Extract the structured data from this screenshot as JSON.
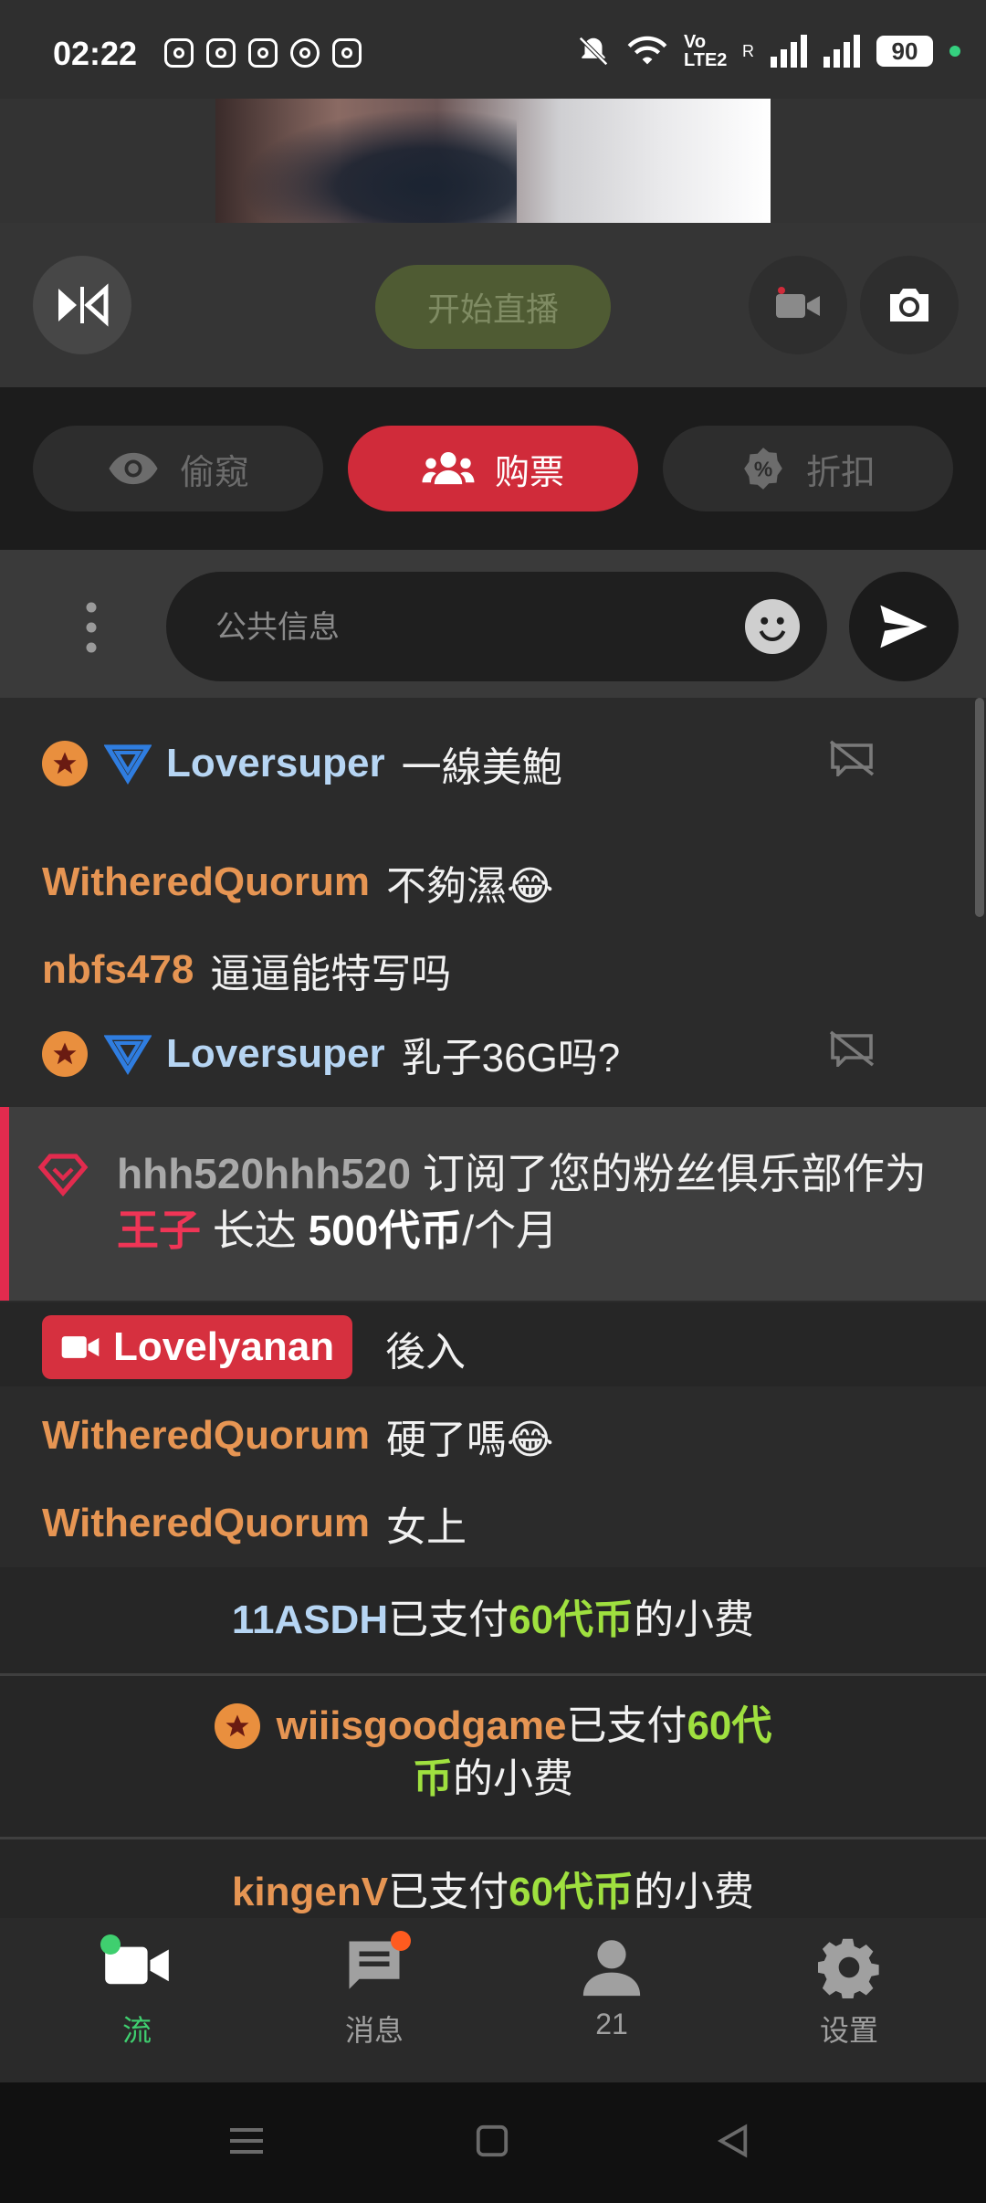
{
  "status_bar": {
    "time": "02:22",
    "network": "Vo LTE2",
    "roaming": "R",
    "battery": "90"
  },
  "controls": {
    "start_label": "开始直播"
  },
  "tabs": [
    {
      "label": "偷窥",
      "icon": "eye-icon",
      "active": false
    },
    {
      "label": "购票",
      "icon": "users-icon",
      "active": true
    },
    {
      "label": "折扣",
      "icon": "discount-icon",
      "active": false
    }
  ],
  "input": {
    "placeholder": "公共信息"
  },
  "chat": [
    {
      "user": "Loversuper",
      "text": "一線美鮑"
    },
    {
      "user": "WitheredQuorum",
      "text": "不夠濕😂"
    },
    {
      "user": "nbfs478",
      "text": "逼逼能特写吗"
    },
    {
      "user": "Loversuper",
      "text": "乳子36G吗?"
    }
  ],
  "subscription": {
    "user": "hhh520hhh520",
    "text1": "订阅了您的粉丝俱乐部作为",
    "rank": "王子",
    "text2": "长达",
    "price": "500代币",
    "text3": "/个月"
  },
  "join": {
    "user": "Lovelyanan",
    "text": "後入"
  },
  "chat2": [
    {
      "user": "WitheredQuorum",
      "text": "硬了嗎😂"
    },
    {
      "user": "WitheredQuorum",
      "text": "女上"
    }
  ],
  "tips": [
    {
      "user": "11ASDH",
      "pre": "已支付",
      "amount": "60代币",
      "post": "的小费"
    },
    {
      "user": "wiiisgoodgame",
      "pre": "已支付",
      "amount": "60代",
      "amount2": "币",
      "post": "的小费"
    },
    {
      "user": "kingenV",
      "pre": "已支付",
      "amount": "60代币",
      "post": "的小费"
    }
  ],
  "nav": [
    {
      "label": "流",
      "icon": "video-camera-icon",
      "active": true
    },
    {
      "label": "消息",
      "icon": "chat-icon",
      "active": false
    },
    {
      "label": "21",
      "icon": "person-icon",
      "active": false
    },
    {
      "label": "设置",
      "icon": "gear-icon",
      "active": false
    }
  ]
}
